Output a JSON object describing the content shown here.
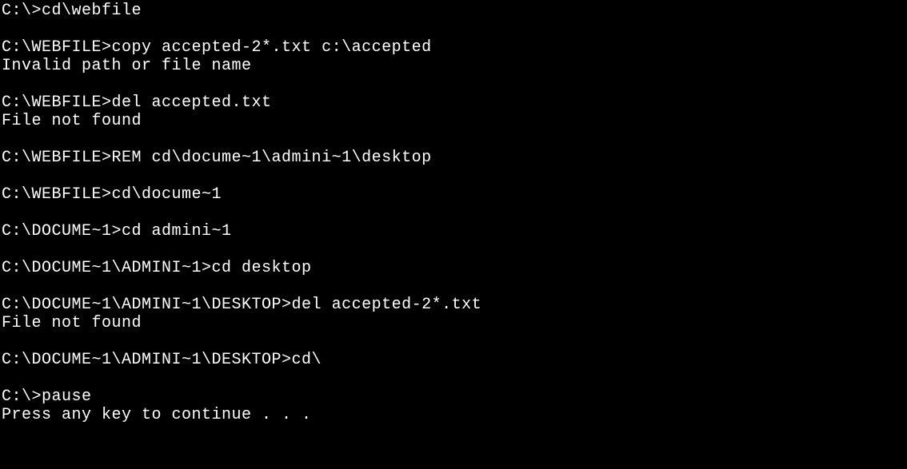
{
  "terminal": {
    "lines": [
      "C:\\>cd\\webfile",
      "",
      "C:\\WEBFILE>copy accepted-2*.txt c:\\accepted",
      "Invalid path or file name",
      "",
      "C:\\WEBFILE>del accepted.txt",
      "File not found",
      "",
      "C:\\WEBFILE>REM cd\\docume~1\\admini~1\\desktop",
      "",
      "C:\\WEBFILE>cd\\docume~1",
      "",
      "C:\\DOCUME~1>cd admini~1",
      "",
      "C:\\DOCUME~1\\ADMINI~1>cd desktop",
      "",
      "C:\\DOCUME~1\\ADMINI~1\\DESKTOP>del accepted-2*.txt",
      "File not found",
      "",
      "C:\\DOCUME~1\\ADMINI~1\\DESKTOP>cd\\",
      "",
      "C:\\>pause",
      "Press any key to continue . . ."
    ]
  }
}
